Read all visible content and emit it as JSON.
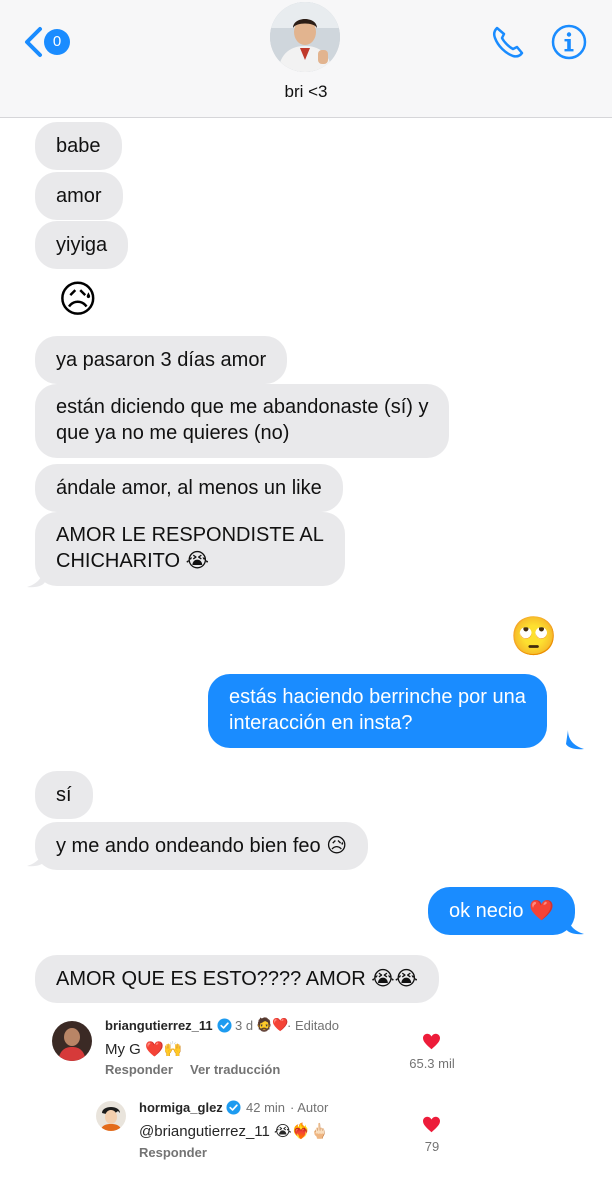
{
  "header": {
    "back_badge": "0",
    "contact_name": "bri <3"
  },
  "messages": [
    {
      "text": "babe",
      "from": "them"
    },
    {
      "text": "amor",
      "from": "them"
    },
    {
      "text": "yiyiga",
      "from": "them"
    },
    {
      "text": "😥",
      "from": "them"
    },
    {
      "text": "ya pasaron 3 días amor",
      "from": "them"
    },
    {
      "line1": "están diciendo que me abandonaste (sí) y",
      "line2": "que ya no me quieres (no)",
      "from": "them"
    },
    {
      "text": "ándale amor, al menos un like",
      "from": "them"
    },
    {
      "line1": "AMOR LE RESPONDISTE AL",
      "line2": "CHICHARITO 😭",
      "from": "them"
    },
    {
      "text": "🙄",
      "from": "me"
    },
    {
      "line1": "estás haciendo berrinche por una",
      "line2": "interacción en insta?",
      "from": "me"
    },
    {
      "text": "sí",
      "from": "them"
    },
    {
      "text": "y me ando ondeando bien feo 😥",
      "from": "them"
    },
    {
      "text": "ok necio ❤️",
      "from": "me"
    },
    {
      "text": "AMOR QUE ES ESTO???? AMOR 😭😭",
      "from": "them"
    }
  ],
  "comments": [
    {
      "username": "briangutierrez_11",
      "time": "3 d",
      "extra": "🧔❤️",
      "edited": "· Editado",
      "text": "My G ❤️🙌",
      "reply": "Responder",
      "translate": "Ver traducción",
      "likes": "65.3 mil"
    },
    {
      "username": "hormiga_glez",
      "time": "42 min",
      "author": "· Autor",
      "text": "@briangutierrez_11 😭❤️‍🔥🖕🏻",
      "reply": "Responder",
      "likes": "79"
    }
  ],
  "colors": {
    "accent": "#1a8cff",
    "incoming": "#e9e9eb",
    "heart": "#ed1c3a",
    "verified": "#1d9bf0"
  },
  "icons": [
    "back-chevron-icon",
    "phone-icon",
    "info-icon",
    "heart-icon",
    "verified-icon"
  ]
}
